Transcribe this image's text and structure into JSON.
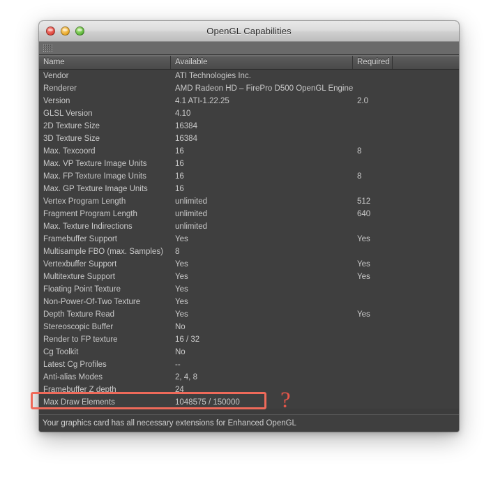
{
  "window": {
    "title": "OpenGL Capabilities",
    "controls": {
      "close_label": "close",
      "minimize_label": "minimize",
      "zoom_label": "zoom"
    },
    "toolbar": {
      "grip_label": "grip-handle"
    }
  },
  "table": {
    "headers": {
      "name": "Name",
      "available": "Available",
      "required": "Required",
      "extra": ""
    },
    "rows": [
      {
        "name": "Vendor",
        "available": "ATI Technologies Inc.",
        "required": ""
      },
      {
        "name": "Renderer",
        "available": "AMD Radeon HD – FirePro D500 OpenGL Engine",
        "required": ""
      },
      {
        "name": "Version",
        "available": "4.1 ATI-1.22.25",
        "required": "2.0"
      },
      {
        "name": "GLSL Version",
        "available": "4.10",
        "required": ""
      },
      {
        "name": "2D Texture Size",
        "available": "16384",
        "required": ""
      },
      {
        "name": "3D Texture Size",
        "available": "16384",
        "required": ""
      },
      {
        "name": "Max. Texcoord",
        "available": "16",
        "required": "8"
      },
      {
        "name": "Max. VP Texture Image Units",
        "available": "16",
        "required": ""
      },
      {
        "name": "Max. FP Texture Image Units",
        "available": "16",
        "required": "8"
      },
      {
        "name": "Max. GP Texture Image Units",
        "available": "16",
        "required": ""
      },
      {
        "name": "Vertex Program Length",
        "available": "unlimited",
        "required": "512"
      },
      {
        "name": "Fragment Program Length",
        "available": "unlimited",
        "required": "640"
      },
      {
        "name": "Max. Texture Indirections",
        "available": "unlimited",
        "required": ""
      },
      {
        "name": "Framebuffer Support",
        "available": "Yes",
        "required": "Yes"
      },
      {
        "name": "Multisample FBO (max. Samples)",
        "available": "8",
        "required": ""
      },
      {
        "name": "Vertexbuffer Support",
        "available": "Yes",
        "required": "Yes"
      },
      {
        "name": "Multitexture Support",
        "available": "Yes",
        "required": "Yes"
      },
      {
        "name": "Floating Point Texture",
        "available": "Yes",
        "required": ""
      },
      {
        "name": "Non-Power-Of-Two Texture",
        "available": "Yes",
        "required": ""
      },
      {
        "name": "Depth Texture Read",
        "available": "Yes",
        "required": "Yes"
      },
      {
        "name": "Stereoscopic Buffer",
        "available": "No",
        "required": ""
      },
      {
        "name": "Render to FP texture",
        "available": "16 / 32",
        "required": ""
      },
      {
        "name": "Cg Toolkit",
        "available": "No",
        "required": ""
      },
      {
        "name": "Latest Cg Profiles",
        "available": "--",
        "required": ""
      },
      {
        "name": "Anti-alias Modes",
        "available": "2, 4, 8",
        "required": ""
      },
      {
        "name": "Framebuffer Z depth",
        "available": "24",
        "required": ""
      },
      {
        "name": "Max Draw Elements",
        "available": "1048575 / 150000",
        "required": ""
      }
    ]
  },
  "status": {
    "message": "Your graphics card has all necessary extensions for Enhanced OpenGL"
  },
  "annotation": {
    "question_mark": "?",
    "highlight_color": "#ef6a5a",
    "highlight_target_row": "Max Draw Elements"
  }
}
